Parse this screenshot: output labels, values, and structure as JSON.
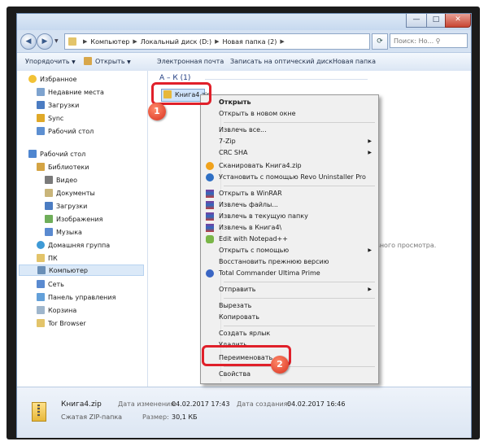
{
  "window": {
    "minimize": "—",
    "maximize": "□",
    "close": "✕"
  },
  "address": {
    "crumbs": [
      "Компьютер",
      "Локальный диск (D:)",
      "Новая папка (2)"
    ],
    "search_placeholder": "Поиск: Но..."
  },
  "toolbar": {
    "organize": "Упорядочить",
    "open": "Открыть",
    "email": "Электронная почта",
    "burn": "Записать на оптический диск",
    "new_folder": "Новая папка"
  },
  "sidebar": {
    "favorites": "Избранное",
    "fav_items": [
      "Недавние места",
      "Загрузки",
      "Sync",
      "Рабочий стол"
    ],
    "desktop": "Рабочий стол",
    "libraries": "Библиотеки",
    "lib_items": [
      "Видео",
      "Документы",
      "Загрузки",
      "Изображения",
      "Музыка"
    ],
    "homegroup": "Домашняя группа",
    "pc": "ПК",
    "computer": "Компьютер",
    "network": "Сеть",
    "control_panel": "Панель управления",
    "recycle": "Корзина",
    "tor": "Tor Browser"
  },
  "main": {
    "group_header": "А – К (1)",
    "file_name": "Книга4.zip",
    "preview_text": "льного просмотра."
  },
  "context_menu": {
    "open": "Открыть",
    "open_new_window": "Открыть в новом окне",
    "extract": "Извлечь все...",
    "sevenzip": "7-Zip",
    "crc": "CRC SHA",
    "scan": "Сканировать Книга4.zip",
    "revo": "Установить с помощью Revo Uninstaller Pro",
    "winrar_open": "Открыть в WinRAR",
    "winrar_extract": "Извлечь файлы...",
    "winrar_here": "Извлечь в текущую папку",
    "winrar_to": "Извлечь в Книга4\\",
    "notepad": "Edit with Notepad++",
    "open_with": "Открыть с помощью",
    "restore": "Восстановить прежнюю версию",
    "totalcmd": "Total Commander Ultima Prime",
    "send_to": "Отправить",
    "cut": "Вырезать",
    "copy": "Копировать",
    "shortcut": "Создать ярлык",
    "delete": "Удалить",
    "rename": "Переименовать",
    "properties": "Свойства"
  },
  "callouts": {
    "one": "1",
    "two": "2"
  },
  "status": {
    "file_name": "Книга4.zip",
    "file_type": "Сжатая ZIP-папка",
    "modified_label": "Дата изменения:",
    "modified_value": "04.02.2017 17:43",
    "size_label": "Размер:",
    "size_value": "30,1 КБ",
    "created_label": "Дата создания:",
    "created_value": "04.02.2017 16:46"
  },
  "colors": {
    "highlight_red": "#e0202a",
    "selection_blue": "#cfe3fb",
    "window_chrome": "#d5e2f2"
  }
}
